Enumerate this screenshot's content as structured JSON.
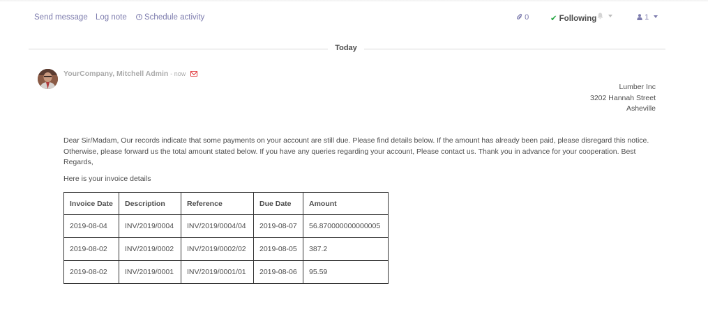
{
  "toolbar": {
    "send_message": "Send message",
    "log_note": "Log note",
    "schedule_activity": "Schedule activity",
    "attachments_count": "0",
    "following_label": "Following",
    "followers_count": "1"
  },
  "separator": {
    "label": "Today"
  },
  "message": {
    "author": "YourCompany, Mitchell Admin",
    "time": "- now",
    "address": {
      "company": "Lumber Inc",
      "street": "3202 Hannah Street",
      "city": "Asheville"
    },
    "body": "Dear Sir/Madam, Our records indicate that some payments on your account are still due. Please find details below. If the amount has already been paid, please disregard this notice. Otherwise, please forward us the total amount stated below. If you have any queries regarding your account, Please contact us. Thank you in advance for your cooperation. Best Regards,",
    "intro": "Here is your invoice details",
    "table": {
      "headers": [
        "Invoice Date",
        "Description",
        "Reference",
        "Due Date",
        "Amount"
      ],
      "rows": [
        [
          "2019-08-04",
          "INV/2019/0004",
          "INV/2019/0004/04",
          "2019-08-07",
          "56.870000000000005"
        ],
        [
          "2019-08-02",
          "INV/2019/0002",
          "INV/2019/0002/02",
          "2019-08-05",
          "387.2"
        ],
        [
          "2019-08-02",
          "INV/2019/0001",
          "INV/2019/0001/01",
          "2019-08-06",
          "95.59"
        ]
      ]
    }
  },
  "colors": {
    "link": "#7c7bad",
    "check": "#28a745",
    "envelope": "#e0363a",
    "text": "#4c4c4c"
  },
  "icons": {
    "schedule": "clock-icon",
    "attachments": "paperclip-icon",
    "following": "check-icon",
    "notifications": "bell-icon",
    "followers": "user-icon",
    "email": "envelope-icon"
  }
}
